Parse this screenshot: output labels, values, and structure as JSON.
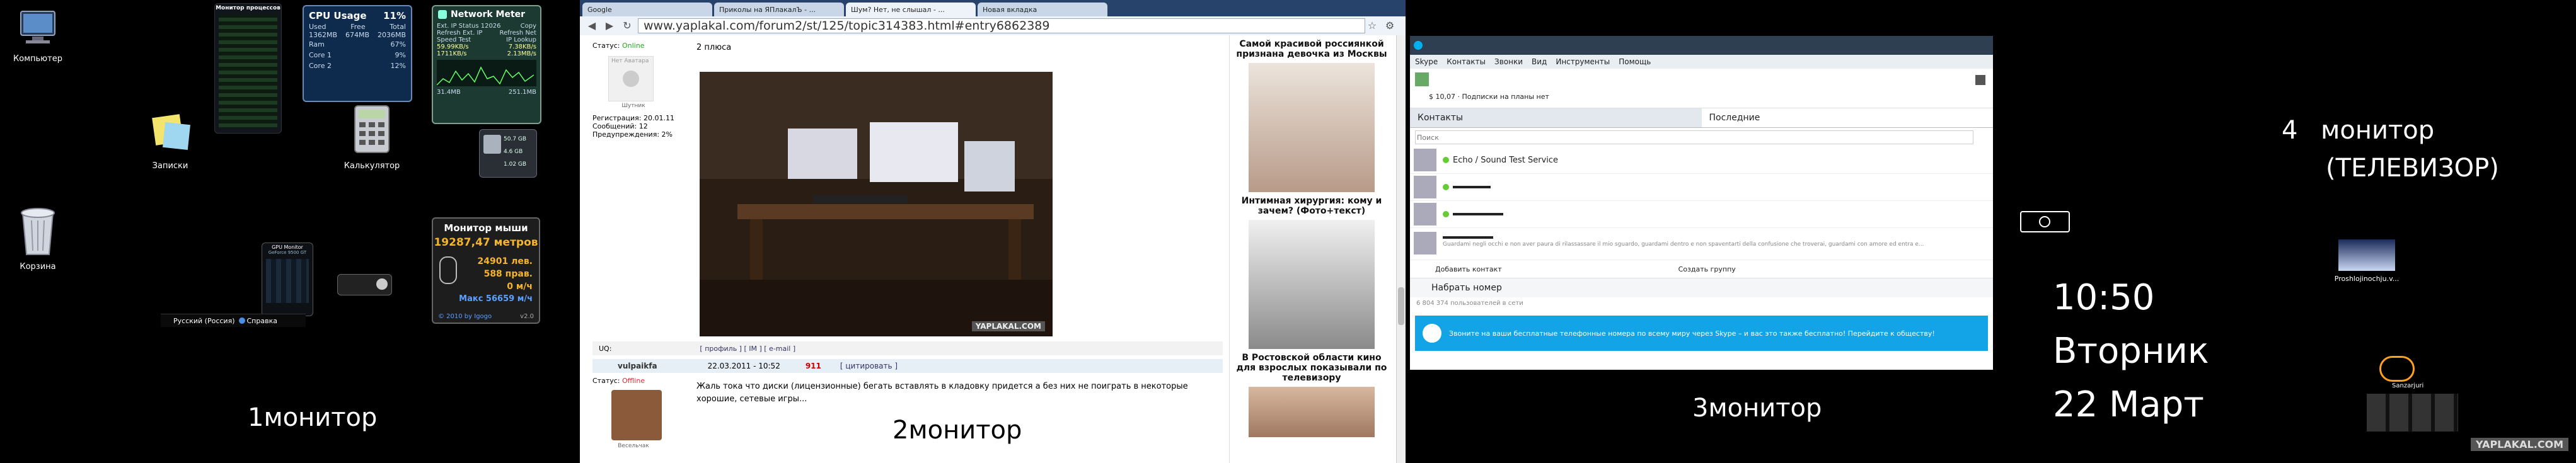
{
  "monitor1": {
    "caption_num": "1",
    "caption_text": "монитор",
    "icons": {
      "computer": "Компьютер",
      "notes": "Записки",
      "calculator": "Калькулятор",
      "recycle": "Корзина"
    },
    "cpu": {
      "title": "CPU Usage",
      "percent": "11%",
      "used_label": "Used",
      "free_label": "Free",
      "total_label": "Total",
      "used": "1362MB",
      "free": "674MB",
      "total": "2036MB",
      "ram_label": "Ram",
      "ram": "67%",
      "core1_label": "Core 1",
      "core1": "9%",
      "core2_label": "Core 2",
      "core2": "12%"
    },
    "network": {
      "title": "Network Meter",
      "ext_ip": "Ext. IP Status 12026",
      "copy": "Copy",
      "refresh_ext": "Refresh Ext. IP",
      "refresh_net": "Refresh Net",
      "speed_test": "Speed Test",
      "ip_lookup": "IP Lookup",
      "down1": "59.99KB/s",
      "up1": "7.38KB/s",
      "down2": "1711KB/s",
      "up2": "2.13MB/s",
      "total_down": "31.4MB",
      "total_up": "251.1MB"
    },
    "mouse_meter": {
      "title": "Монитор мыши",
      "distance": "19287,47 метров",
      "left": "24901 лев.",
      "right": "588 прав.",
      "speed": "0 м/ч",
      "max": "Макс 56659 м/ч",
      "footer": "© 2010 by Igogo",
      "version": "v2.0"
    },
    "hdd": {
      "line1": "50.7 GB",
      "line2": "4.6 GB",
      "line3": "1.02 GB"
    },
    "taskbar_lang": "Русский (Россия)",
    "taskbar_help": "Справка",
    "gpu_title": "GPU Monitor",
    "gpu_sub": "GeForce 9500 GT",
    "processes_title": "Монитор процессов"
  },
  "monitor2": {
    "caption_num": "2",
    "caption_text": "монитор",
    "tabs": [
      "Google",
      "Приколы на ЯПлакалЪ - ...",
      "Шум? Нет, не слышал - ...",
      "Новая вкладка"
    ],
    "url": "www.yaplakal.com/forum2/st/125/topic314383.html#entry6862389",
    "post1": {
      "status_label": "Статус:",
      "status": "Online",
      "avatar_caption": "Нет Аватара",
      "user_sub": "Шутник",
      "reg": "Регистрация: 20.01.11",
      "messages": "Сообщений: 12",
      "warnings": "Предупреждения: 2%",
      "body": "2 плюса",
      "watermark": "YAPLAKAL.COM",
      "rating": "UQ: ",
      "links": "[ профиль ] [ IM ] [ e-mail ]"
    },
    "post2": {
      "nick": "vulpaikfa",
      "date": "22.03.2011 - 10:52",
      "post_id": "911",
      "quote": "[ цитировать ]",
      "status_label": "Статус:",
      "status": "Offline",
      "user_sub": "Весельчак",
      "body": "Жаль тока что диски (лицензионные) бегать вставлять в кладовку придется   а без них не поиграть в некоторые хорошие, сетевые игры..."
    },
    "ads": [
      "Самой красивой россиянкой признана девочка из Москвы",
      "Интимная хирургия: кому и зачем? (Фото+текст)",
      "В Ростовской области кино для взрослых показывали по телевизору"
    ]
  },
  "monitor3": {
    "caption_num": "3",
    "caption_text": "монитор",
    "menu": [
      "Skype",
      "Контакты",
      "Звонки",
      "Вид",
      "Инструменты",
      "Помощь"
    ],
    "balance": "$ 10,07 · Подписки на планы нет",
    "tab_contacts": "Контакты",
    "tab_recent": "Последние",
    "search_placeholder": "Поиск",
    "contact1": "Echo / Sound Test Service",
    "status_line": "Guardami negli occhi e non aver paura di rilassassare il mio sguardo, guardami dentro e non spaventarti della confusione che troverai, guardami con amore ed entra e...",
    "add_contact": "Добавить контакт",
    "create_group": "Создать группу",
    "dial": "Набрать номер",
    "online_count": "6 804 374 пользователей в сети",
    "promo": "Звоните на ваши бесплатные телефонные номера по всему миру через Skype – и вас это также бесплатно! Перейдите к обществу!"
  },
  "monitor4": {
    "caption_num": "4",
    "caption_line1": "монитор",
    "caption_line2": "(ТЕЛЕВИЗОР)",
    "time": "10:50",
    "day": "Вторник",
    "date": "22 Март",
    "file_label": "Proshlojinochju.v...",
    "watermark": "YAPLAKAL.COM",
    "weather_city": "Sanzarjuri"
  }
}
